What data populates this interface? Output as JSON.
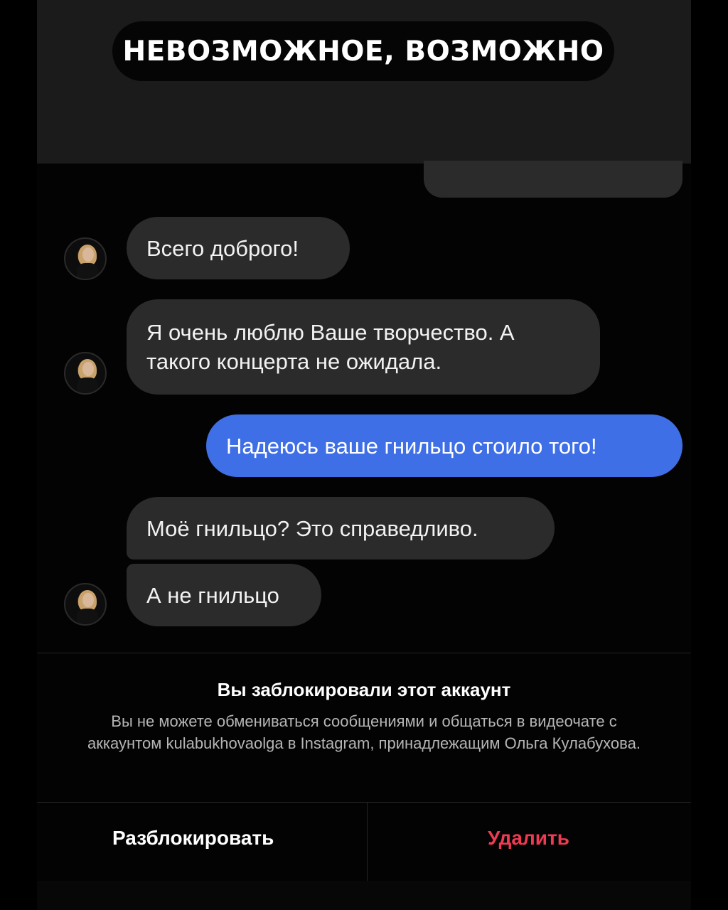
{
  "banner": {
    "title": "НЕВОЗМОЖНОЕ, ВОЗМОЖНО"
  },
  "messages": [
    {
      "direction": "incoming",
      "text": "Всего доброго!"
    },
    {
      "direction": "incoming",
      "text": "Я очень люблю Ваше творчество. А такого концерта не ожидала."
    },
    {
      "direction": "outgoing",
      "text": "Надеюсь ваше гнильцо стоило того!"
    },
    {
      "direction": "incoming",
      "text": "Моё гнильцо? Это справедливо."
    },
    {
      "direction": "incoming",
      "text": "А не гнильцо"
    }
  ],
  "blocked_notice": {
    "title": "Вы заблокировали этот аккаунт",
    "description": "Вы не можете обмениваться сообщениями и общаться в видеочате с аккаунтом kulabukhovaolga в Instagram, принадлежащим Ольга Кулабухова."
  },
  "actions": {
    "unblock_label": "Разблокировать",
    "delete_label": "Удалить"
  },
  "colors": {
    "outgoing_bubble": "#3f6fe6",
    "incoming_bubble": "#2b2b2b",
    "delete_action": "#ef3a52"
  }
}
